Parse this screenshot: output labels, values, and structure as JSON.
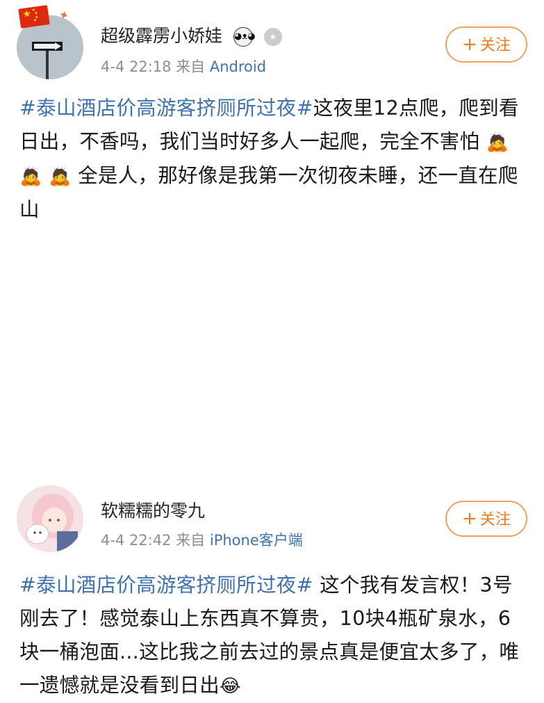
{
  "posts": [
    {
      "username": "超级霹雳小娇娃",
      "badge1_icon": "panda-icon",
      "badge2_icon": "medal-icon",
      "date": "4-4 22:18",
      "via": "来自",
      "source": "Android",
      "follow_label": "关注",
      "hashtag": "#泰山酒店价高游客挤厕所过夜#",
      "text_a": "这夜里12点爬，爬到看日出，不香吗，我们当时好多人一起爬，完全不害怕",
      "emojis": [
        "🙇",
        "🙇",
        "🙇"
      ],
      "text_b": "全是人，那好像是我第一次彻夜未睡，还一直在爬山"
    },
    {
      "username": "软糯糯的零九",
      "date": "4-4 22:42",
      "via": "来自",
      "source": "iPhone客户端",
      "follow_label": "关注",
      "hashtag": "#泰山酒店价高游客挤厕所过夜#",
      "text_a": " 这个我有发言权！3号刚去了！感觉泰山上东西真不算贵，10块4瓶矿泉水，6块一桶泡面...这比我之前去过的景点真是便宜太多了，唯一遗憾就是没看到日出",
      "emoji_end": "😂"
    }
  ],
  "colors": {
    "link": "#3e72b0",
    "follow_border": "#f0a25a",
    "follow_text": "#f07a1e",
    "meta": "#8d8d8d"
  }
}
